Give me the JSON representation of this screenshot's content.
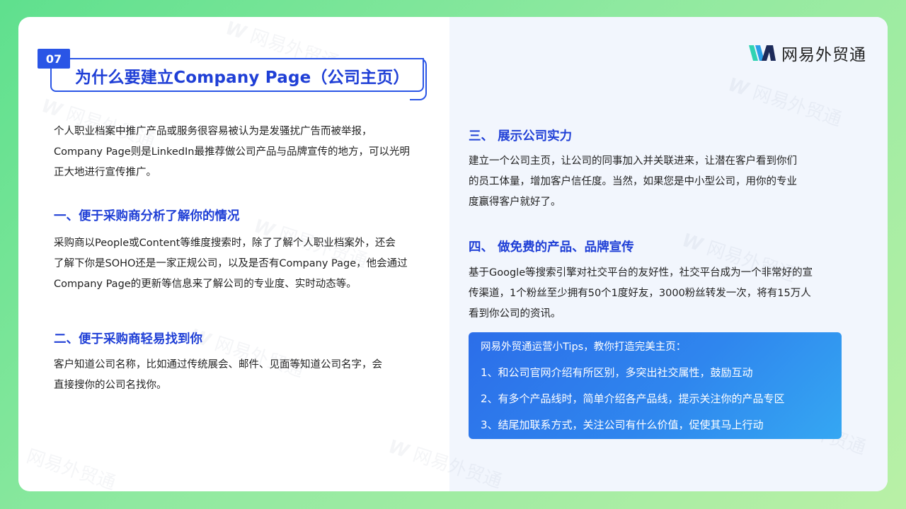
{
  "brand": {
    "logo_text": "网易外贸通",
    "colors": {
      "accent": "#1f3fd6",
      "badge": "#2a55e6",
      "tip_start": "#2c6ee9",
      "tip_end": "#35a7f2"
    }
  },
  "watermark": "网易外贸通",
  "section": {
    "number": "07",
    "title": "为什么要建立Company Page（公司主页）"
  },
  "intro": [
    "个人职业档案中推广产品或服务很容易被认为是发骚扰广告而被举报，",
    "Company Page则是LinkedIn最推荐做公司产品与品牌宣传的地方，可以光明",
    "正大地进行宣传推广。"
  ],
  "points": [
    {
      "heading": "一、便于采购商分析了解你的情况",
      "lines": [
        "采购商以People或Content等维度搜索时，除了了解个人职业档案外，还会",
        "了解下你是SOHO还是一家正规公司，以及是否有Company Page，他会通过",
        "Company Page的更新等信息来了解公司的专业度、实时动态等。"
      ]
    },
    {
      "heading": "二、便于采购商轻易找到你",
      "lines": [
        "客户知道公司名称，比如通过传统展会、邮件、见面等知道公司名字，会",
        "直接搜你的公司名找你。"
      ]
    },
    {
      "heading": "三、 展示公司实力",
      "lines": [
        "建立一个公司主页，让公司的同事加入并关联进来，让潜在客户看到你们",
        "的员工体量，增加客户信任度。当然，如果您是中小型公司，用你的专业",
        "度赢得客户就好了。"
      ]
    },
    {
      "heading": "四、 做免费的产品、品牌宣传",
      "lines": [
        "基于Google等搜索引擎对社交平台的友好性，社交平台成为一个非常好的宣",
        "传渠道，1个粉丝至少拥有50个1度好友，3000粉丝转发一次，将有15万人",
        "看到你公司的资讯。"
      ]
    }
  ],
  "tips": {
    "title": "网易外贸通运营小Tips，教你打造完美主页：",
    "items": [
      "1、和公司官网介绍有所区别，多突出社交属性，鼓励互动",
      "2、有多个产品线时，简单介绍各产品线，提示关注你的产品专区",
      "3、结尾加联系方式，关注公司有什么价值，促使其马上行动"
    ]
  }
}
